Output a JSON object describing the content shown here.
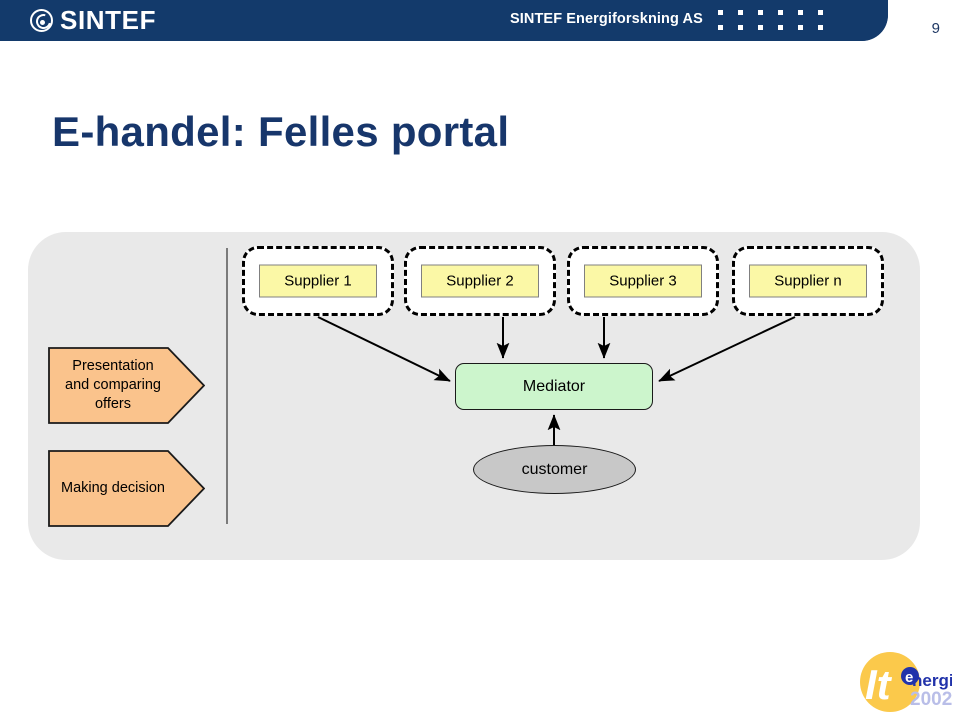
{
  "header": {
    "brand": "SINTEF",
    "brand_icon": "sintef-swirl-icon",
    "unit_name": "SINTEF Energiforskning AS",
    "slide_number": "9",
    "bar_color": "#133A6B",
    "dot_count": 12
  },
  "title": "E-handel: Felles portal",
  "title_color": "#17366B",
  "diagram": {
    "panel_color": "#E9E9E9",
    "suppliers": [
      {
        "label": "Supplier 1"
      },
      {
        "label": "Supplier 2"
      },
      {
        "label": "Supplier 3"
      },
      {
        "label": "Supplier n"
      }
    ],
    "supplier_box_color": "#FBF8A6",
    "processes": [
      {
        "label": "Presentation and comparing offers",
        "lines": [
          "Presentation",
          "and comparing",
          "offers"
        ]
      },
      {
        "label": "Making decision",
        "lines": [
          "Making decision"
        ]
      }
    ],
    "process_color": "#FAC38C",
    "mediator": {
      "label": "Mediator",
      "color": "#CCF5CC"
    },
    "customer": {
      "label": "customer",
      "color": "#C8C8C8"
    }
  },
  "footer_logo": {
    "name": "it-energi-2002-logo",
    "circle_text": "It",
    "word": "energi",
    "year": "2002",
    "circle_color": "#FBC94B",
    "word_color": "#2233AA",
    "year_color": "#B9BEE8"
  }
}
